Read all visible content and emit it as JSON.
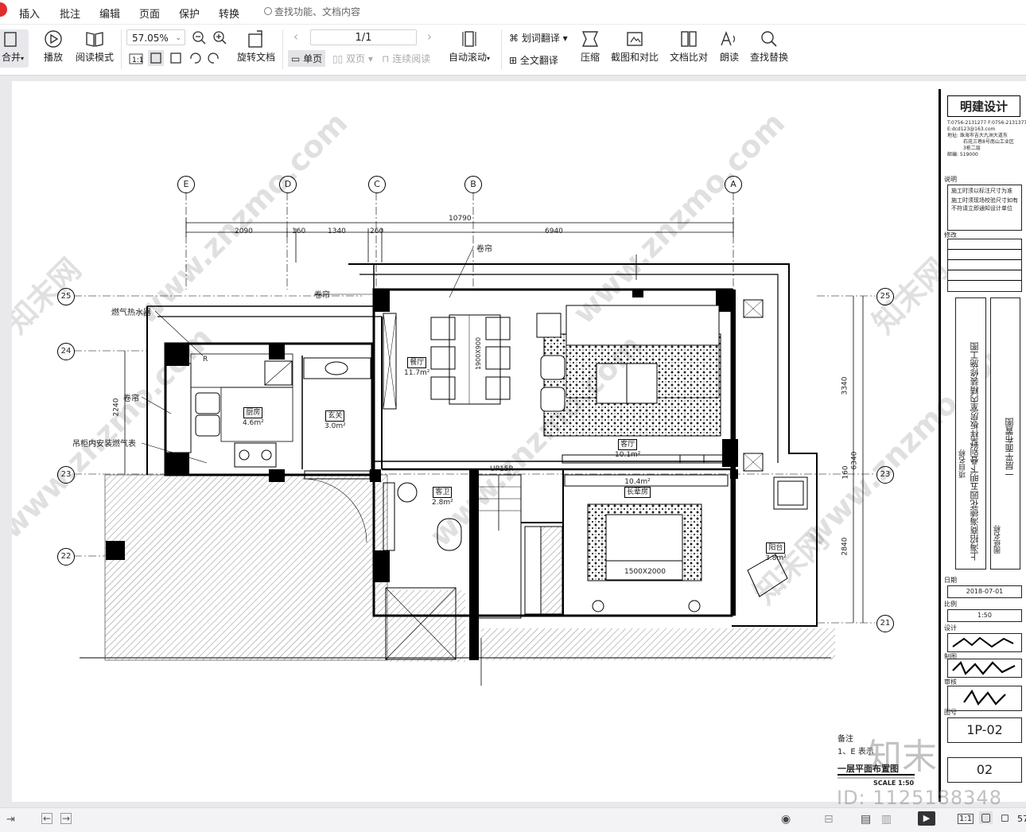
{
  "menu": {
    "items": [
      "插入",
      "批注",
      "编辑",
      "页面",
      "保护",
      "转换"
    ],
    "search_text": "查找功能、文档内容"
  },
  "toolbar": {
    "merge": "合并",
    "play": "播放",
    "read_mode": "阅读模式",
    "zoom": "57.05%",
    "rotate_doc": "旋转文档",
    "page_indicator": "1/1",
    "single_page": "单页",
    "double_page": "双页",
    "continuous": "连续阅读",
    "auto_scroll": "自动滚动",
    "translate_selection": "划词翻译",
    "translate_full": "全文翻译",
    "compress": "压缩",
    "crop_compare": "截图和对比",
    "doc_compare": "文档比对",
    "read_aloud": "朗读",
    "find_replace": "查找替换"
  },
  "drawing": {
    "axes_top": [
      "E",
      "D",
      "C",
      "B",
      "A"
    ],
    "axes_side": [
      "25",
      "24",
      "23",
      "22",
      "21"
    ],
    "dims_top": [
      "2090",
      "160",
      "1340",
      "260",
      "6940"
    ],
    "dim_total": "10790",
    "dims_left": [
      "2240"
    ],
    "dims_right": [
      "3340",
      "6340",
      "160",
      "2840"
    ],
    "labels": {
      "curtain": "卷帘",
      "gas_heater": "燃气热水器",
      "gas_meter": "吊柜内安装燃气表",
      "stair": "UP15R",
      "bed_size": "1500X2000",
      "table_size": "1900X900",
      "kitchen_sink_tag": "R"
    },
    "rooms": [
      {
        "name": "餐厅",
        "area": "11.7m²"
      },
      {
        "name": "厨房",
        "area": "4.6m²"
      },
      {
        "name": "玄关",
        "area": "3.0m²"
      },
      {
        "name": "客厅",
        "area": "10.1m²"
      },
      {
        "name": "客卫",
        "area": "2.8m²"
      },
      {
        "name": "长辈房",
        "area": "10.4m²"
      },
      {
        "name": "阳台",
        "area": "3.8m²"
      }
    ],
    "notes_title": "备注",
    "notes_line": "1、E 表示",
    "plan_title": "一层平面布置图",
    "scale": "SCALE 1:50"
  },
  "titleblock": {
    "company": "明建设计",
    "contact": [
      "T:0756-2131277 F:0756-2131377",
      "E:dcd123@163.com",
      "地址: 珠海市吉大九洲大道东",
      "石花三巷8号南山工业区",
      "3栋二层",
      "邮编: 519000"
    ],
    "notes_label": "说明",
    "notes": [
      "施工时须以标注尺寸为准",
      "施工时须现场校验尺寸如有不符请立即通知设计单位"
    ],
    "revision_label": "修改",
    "project_label": "项目名称",
    "project_name": "上海招商海德花园五明下叠别墅样板房室内精装修施工图",
    "drawing_label": "图纸名称",
    "drawing_name": "一层平面布置图",
    "date_label": "日期",
    "date": "2018-07-01",
    "scale_label": "比例",
    "scale": "1:50",
    "design_label": "设计",
    "draw_label": "制图",
    "review_label": "审核",
    "number_label": "图号",
    "number": "1P-02",
    "sheet": "02"
  },
  "watermark": {
    "site": "www.znzmo.com",
    "brand": "知末网",
    "big": "知末",
    "id": "ID: 1125188348"
  },
  "statusbar": {
    "page_right": "57"
  }
}
